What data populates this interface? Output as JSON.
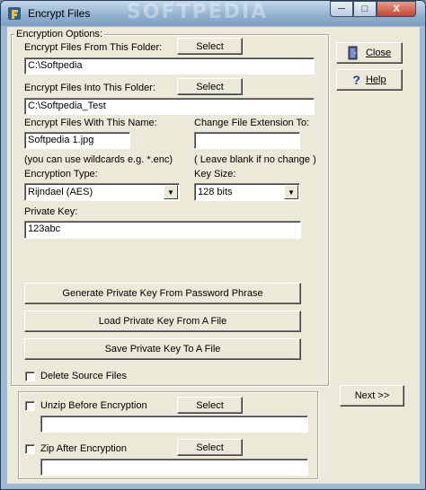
{
  "window": {
    "title": "Encrypt Files",
    "watermark": "SOFTPEDIA",
    "controls": {
      "minimize": "─",
      "maximize": "□",
      "close": "X"
    }
  },
  "options": {
    "group_title": "Encryption Options:",
    "from_folder": {
      "label": "Encrypt Files From This Folder:",
      "button": "Select",
      "value": "C:\\Softpedia"
    },
    "into_folder": {
      "label": "Encrypt Files Into This Folder:",
      "button": "Select",
      "value": "C:\\Softpedia_Test"
    },
    "name": {
      "label": "Encrypt Files With This Name:",
      "value": "Softpedia 1.jpg",
      "hint": "(you can use wildcards e.g. *.enc)"
    },
    "extension": {
      "label": "Change File Extension To:",
      "value": "",
      "hint": "( Leave blank if no change )"
    },
    "encryption_type": {
      "label": "Encryption Type:",
      "value": "Rijndael (AES)"
    },
    "key_size": {
      "label": "Key Size:",
      "value": "128 bits"
    },
    "private_key": {
      "label": "Private Key:",
      "value": "123abc"
    },
    "generate_button": "Generate Private Key From Password Phrase",
    "load_button": "Load Private Key From A File",
    "save_button": "Save Private Key To A File",
    "delete_source": {
      "label": "Delete Source Files",
      "checked": false
    }
  },
  "archive": {
    "unzip": {
      "label": "Unzip Before Encryption",
      "checked": false,
      "button": "Select",
      "value": ""
    },
    "zip": {
      "label": "Zip After Encryption",
      "checked": false,
      "button": "Select",
      "value": ""
    }
  },
  "side": {
    "close_button": "Close",
    "help_button": "Help",
    "next_button": "Next >>"
  }
}
